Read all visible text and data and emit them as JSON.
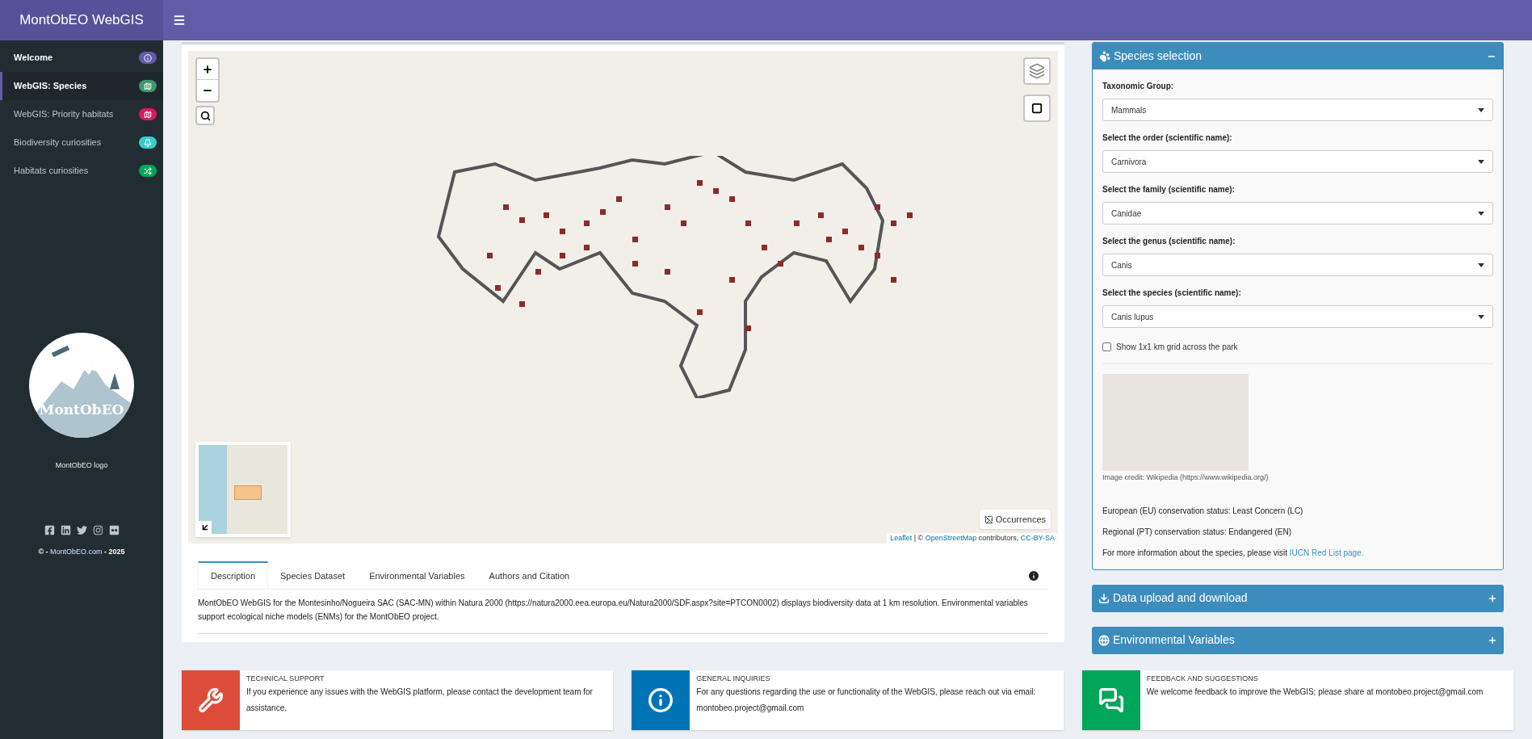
{
  "header": {
    "title": "MontObEO WebGIS"
  },
  "sidebar": {
    "items": [
      {
        "label": "Welcome",
        "color": "#605ca8",
        "emphasized": true,
        "selected": false
      },
      {
        "label": "WebGIS: Species",
        "color": "#3d9970",
        "emphasized": true,
        "selected": true
      },
      {
        "label": "WebGIS: Priority habitats",
        "color": "#d81b60",
        "emphasized": false,
        "selected": false
      },
      {
        "label": "Biodiversity curiosities",
        "color": "#39cccc",
        "emphasized": false,
        "selected": false
      },
      {
        "label": "Habitats curiosities",
        "color": "#00a65a",
        "emphasized": false,
        "selected": false
      }
    ],
    "logo_caption": "MontObEO logo",
    "logo_text": "MontObEO",
    "copyright": {
      "prefix": "© - ",
      "link": "MontObEO.com",
      "suffix": " - 2025"
    }
  },
  "map": {
    "layer_button": "Occurrences",
    "attribution": [
      {
        "text": "Leaflet",
        "kind": "link"
      },
      {
        "text": " | © ",
        "kind": "text"
      },
      {
        "text": "OpenStreetMap",
        "kind": "link"
      },
      {
        "text": " contributors, ",
        "kind": "text"
      },
      {
        "text": "CC-BY-SA",
        "kind": "link"
      }
    ]
  },
  "tabs": [
    {
      "label": "Description",
      "selected": true
    },
    {
      "label": "Species Dataset",
      "selected": false
    },
    {
      "label": "Environmental Variables",
      "selected": false
    },
    {
      "label": "Authors and Citation",
      "selected": false
    }
  ],
  "description": "MontObEO WebGIS for the Montesinho/Nogueira SAC (SAC-MN) within Natura 2000 (https://natura2000.eea.europa.eu/Natura2000/SDF.aspx?site=PTCON0002) displays biodiversity data at 1 km resolution. Environmental variables support ecological niche models (ENMs) for the MontObEO project.",
  "species_panel": {
    "title": "Species selection",
    "expanded": true,
    "selects": [
      {
        "label": "Taxonomic Group:",
        "value": "Mammals"
      },
      {
        "label": "Select the order (scientific name):",
        "value": "Carnivora"
      },
      {
        "label": "Select the family (scientific name):",
        "value": "Canidae"
      },
      {
        "label": "Select the genus (scientific name):",
        "value": "Canis"
      },
      {
        "label": "Select the species (scientific name):",
        "value": "Canis lupus"
      }
    ],
    "grid_checkbox": {
      "label": "Show 1x1 km grid across the park",
      "checked": false
    },
    "image_credit": "Image credit: Wikipedia (https://www.wikipedia.org/)",
    "status_lines": [
      "European (EU) conservation status: Least Concern (LC)",
      "Regional (PT) conservation status: Endangered (EN)"
    ],
    "more_info": {
      "text": "For more information about the species, please visit ",
      "link": "IUCN Red List page."
    }
  },
  "collapsed_panels": [
    {
      "title": "Data upload and download",
      "expanded": false
    },
    {
      "title": "Environmental Variables",
      "expanded": false
    }
  ],
  "info_boxes": [
    {
      "title": "TECHNICAL SUPPORT",
      "text": "If you experience any issues with the WebGIS platform, please contact the development team for assistance.",
      "color": "#dd4b39"
    },
    {
      "title": "GENERAL INQUIRIES",
      "text": "For any questions regarding the use or functionality of the WebGIS, please reach out via email: montobeo.project@gmail.com",
      "color": "#0073b7"
    },
    {
      "title": "FEEDBACK AND SUGGESTIONS",
      "text": "We welcome feedback to improve the WebGIS; please share at montobeo.project@gmail.com",
      "color": "#00a65a"
    }
  ]
}
